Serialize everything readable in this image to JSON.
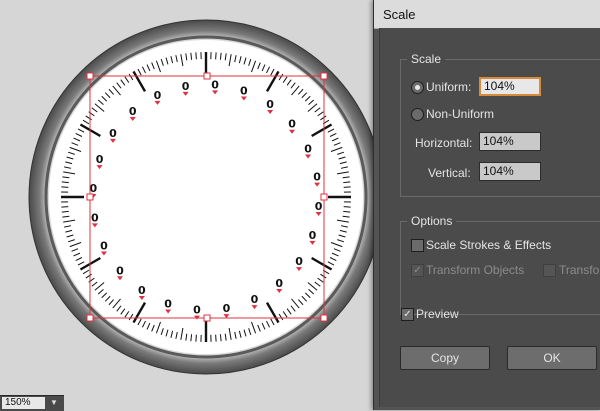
{
  "canvas": {
    "dial_label": "0",
    "zoom": {
      "value": "150%"
    }
  },
  "dialog": {
    "title": "Scale",
    "scale_group": {
      "legend": "Scale",
      "uniform_label": "Uniform:",
      "uniform_value": "104%",
      "non_uniform_label": "Non-Uniform",
      "horizontal_label": "Horizontal:",
      "horizontal_value": "104%",
      "vertical_label": "Vertical:",
      "vertical_value": "104%"
    },
    "options_group": {
      "legend": "Options",
      "scale_strokes_label": "Scale Strokes & Effects",
      "transform_objects_label": "Transform Objects",
      "transform_patterns_label": "Transfo"
    },
    "preview_label": "Preview",
    "copy_label": "Copy",
    "ok_label": "OK"
  },
  "colors": {
    "dialog_bg": "#4b4b4b",
    "field_focus": "#d68a3c",
    "selection": "#e03040"
  }
}
